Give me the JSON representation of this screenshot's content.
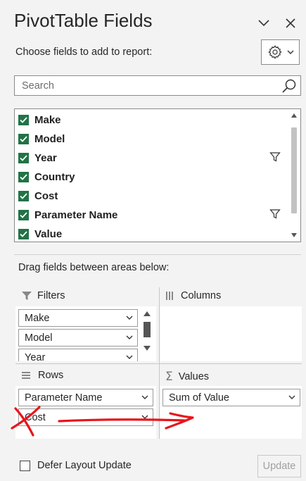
{
  "panel": {
    "title": "PivotTable Fields",
    "subtitle": "Choose fields to add to report:",
    "search_placeholder": "Search",
    "drag_hint": "Drag fields between areas below:"
  },
  "fields": [
    {
      "label": "Make",
      "checked": true,
      "filtered": false
    },
    {
      "label": "Model",
      "checked": true,
      "filtered": false
    },
    {
      "label": "Year",
      "checked": true,
      "filtered": true
    },
    {
      "label": "Country",
      "checked": true,
      "filtered": false
    },
    {
      "label": "Cost",
      "checked": true,
      "filtered": false
    },
    {
      "label": "Parameter Name",
      "checked": true,
      "filtered": true
    },
    {
      "label": "Value",
      "checked": true,
      "filtered": false
    }
  ],
  "areas": {
    "filters": {
      "label": "Filters",
      "items": [
        "Make",
        "Model",
        "Year"
      ]
    },
    "columns": {
      "label": "Columns",
      "items": []
    },
    "rows": {
      "label": "Rows",
      "items": [
        "Parameter Name",
        "Cost"
      ]
    },
    "values": {
      "label": "Values",
      "items": [
        "Sum of Value"
      ]
    }
  },
  "footer": {
    "defer_label": "Defer Layout Update",
    "update_label": "Update"
  },
  "colors": {
    "checkbox": "#217346",
    "annotation": "#e8141b"
  },
  "icons": [
    "chevron-down-icon",
    "close-icon",
    "gear-icon",
    "search-icon",
    "filter-icon",
    "columns-icon",
    "rows-icon",
    "sigma-icon"
  ]
}
